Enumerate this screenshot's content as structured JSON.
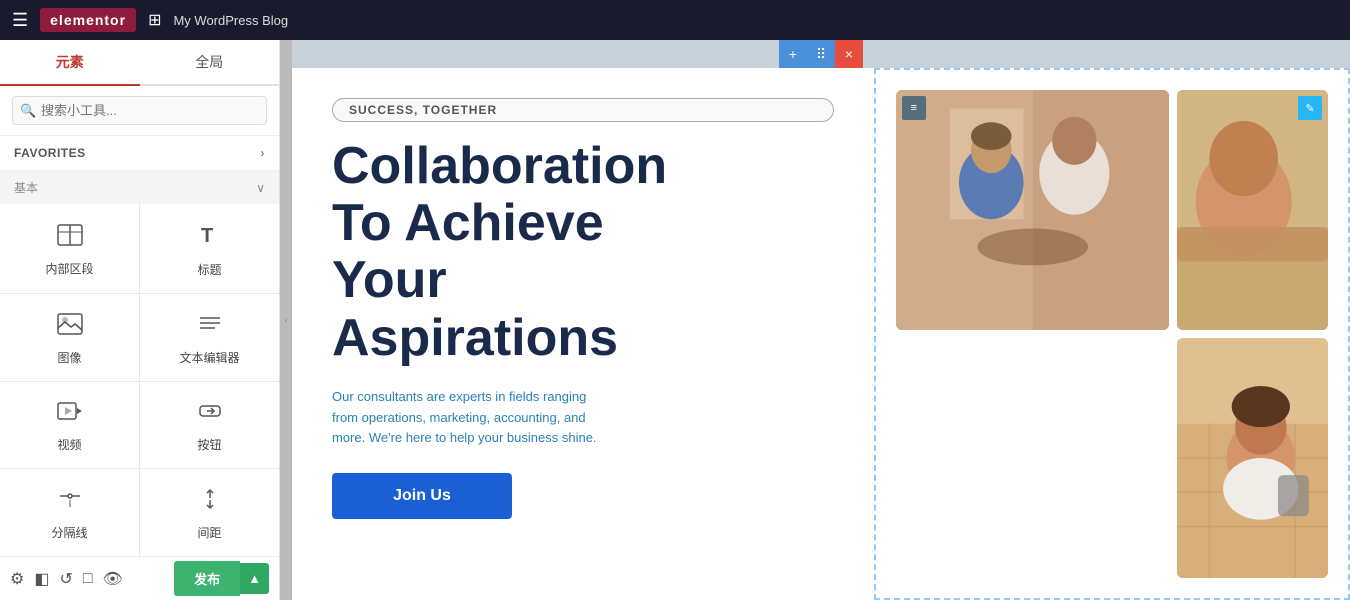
{
  "topbar": {
    "menu_icon": "☰",
    "logo": "elementor",
    "grid_icon": "⊞",
    "site_name": "My WordPress Blog"
  },
  "sidebar": {
    "tabs": [
      {
        "label": "元素",
        "active": true
      },
      {
        "label": "全局",
        "active": false
      }
    ],
    "search_placeholder": "搜索小工具...",
    "favorites_label": "FAVORITES",
    "favorites_arrow": "›",
    "section_basic": "基本",
    "widgets": [
      {
        "icon": "≡≡",
        "label": "内部区段",
        "unicode": "⊟"
      },
      {
        "icon": "T",
        "label": "标题",
        "unicode": "T"
      },
      {
        "icon": "🖼",
        "label": "图像",
        "unicode": "⬚"
      },
      {
        "icon": "≡",
        "label": "文本编辑器",
        "unicode": "≣"
      },
      {
        "icon": "▶",
        "label": "视频",
        "unicode": "▷"
      },
      {
        "icon": "↑",
        "label": "按钮",
        "unicode": "↑"
      },
      {
        "icon": "−",
        "label": "分隔线",
        "unicode": "—"
      },
      {
        "icon": "⊟",
        "label": "间距",
        "unicode": "⇕"
      }
    ]
  },
  "bottom_bar": {
    "icon_settings": "⚙",
    "icon_layers": "◧",
    "icon_history": "↺",
    "icon_responsive": "□",
    "icon_preview": "👁",
    "publish_label": "发布",
    "publish_arrow": "▲"
  },
  "canvas": {
    "toolbar": {
      "add_icon": "+",
      "drag_icon": "⠿",
      "close_icon": "×"
    }
  },
  "page": {
    "badge": "SUCCESS, TOGETHER",
    "title_line1": "Collaboration",
    "title_line2": "To Achieve",
    "title_line3": "Your",
    "title_line4": "Aspirations",
    "description": "Our consultants are experts in fields ranging from operations, marketing, accounting, and more. We're here to help your business shine.",
    "cta_button": "Join Us",
    "img_handle_left": "≡",
    "img_handle_right": "✎"
  }
}
